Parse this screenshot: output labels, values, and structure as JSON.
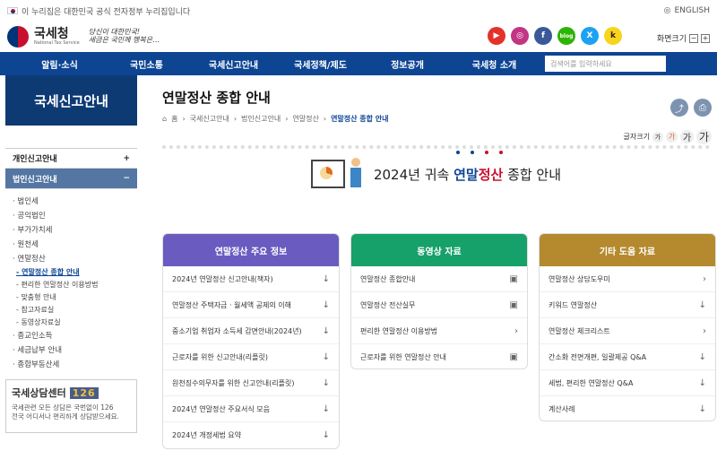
{
  "topbar": {
    "notice": "이 누리집은 대한민국 공식 전자정부 누리집입니다",
    "lang": "ENGLISH"
  },
  "header": {
    "logo": "국세청",
    "logo_sub": "National Tax Service",
    "slogan_line1": "당신이 대한민국!",
    "slogan_line2": "세금은 국민께 행복은…",
    "fontsize_label": "화면크기",
    "fontsize_minus": "−",
    "fontsize_plus": "+",
    "sns": [
      "▶",
      "◎",
      "f",
      "blog",
      "X",
      "k"
    ]
  },
  "gnb": {
    "items": [
      "알림·소식",
      "국민소통",
      "국세신고안내",
      "국세정책/제도",
      "정보공개",
      "국세청 소개"
    ],
    "search_placeholder": "검색어를 입력하세요"
  },
  "lnb": {
    "title": "국세신고안내",
    "sec1": "개인신고안내",
    "sec1_icon": "+",
    "sec2": "법인신고안내",
    "sec2_icon": "−",
    "items": [
      "법인세",
      "공익법인",
      "부가가치세",
      "원천세",
      "연말정산"
    ],
    "subitems": [
      "연말정산 종합 안내",
      "편리한 연말정산 이용방법",
      "맞춤형 안내",
      "참고자료실",
      "동영상자료실"
    ],
    "items2": [
      "종교인소득",
      "세금납부 안내",
      "종합부동산세"
    ],
    "consult_title": "국세상담센터",
    "consult_num": "126",
    "consult_desc1": "국세관련 모든 상담은 국번없이 126",
    "consult_desc2": "전국 어디서나 편리하게 상담받으세요."
  },
  "content": {
    "title": "연말정산 종합 안내",
    "breadcrumb": [
      "홈",
      "국세신고안내",
      "법인신고안내",
      "연말정산",
      "연말정산 종합 안내"
    ],
    "textsize_label": "글자크기",
    "textsize_levels": [
      "가",
      "가",
      "가",
      "가"
    ],
    "banner_prefix": "2024년 귀속 ",
    "banner_hl1": "연말",
    "banner_hl2": "정산",
    "banner_suffix": " 종합 안내"
  },
  "cards": [
    {
      "title": "연말정산 주요 정보",
      "color": "#6a5bc0",
      "rows": [
        {
          "label": "2024년 연말정산 신고안내(책자)",
          "icon": "↓"
        },
        {
          "label": "연말정산 주택자금 · 월세액 공제의 이해",
          "icon": "↓"
        },
        {
          "label": "중소기업 취업자 소득세 감면안내(2024년)",
          "icon": "↓"
        },
        {
          "label": "근로자를 위한 신고안내(리플릿)",
          "icon": "↓"
        },
        {
          "label": "원천징수의무자를 위한 신고안내(리플릿)",
          "icon": "↓"
        },
        {
          "label": "2024년 연말정산 주요서식 모음",
          "icon": "↓"
        },
        {
          "label": "2024년 개정세법 요약",
          "icon": "↓"
        }
      ]
    },
    {
      "title": "동영상 자료",
      "color": "#16a06a",
      "rows": [
        {
          "label": "연말정산 종합안내",
          "icon": "▣"
        },
        {
          "label": "연말정산 전산실무",
          "icon": "▣"
        },
        {
          "label": "편리한 연말정산 이용방법",
          "icon": "›"
        },
        {
          "label": "근로자를 위한 연말정산 안내",
          "icon": "▣"
        }
      ]
    },
    {
      "title": "기타 도움 자료",
      "color": "#b58a2e",
      "rows": [
        {
          "label": "연말정산 상담도우미",
          "icon": "›"
        },
        {
          "label": "키워드 연말정산",
          "icon": "↓"
        },
        {
          "label": "연말정산 체크리스트",
          "icon": "›"
        },
        {
          "label": "간소화 전면개편, 일괄제공 Q&A",
          "icon": "↓"
        },
        {
          "label": "세법, 편리한 연말정산 Q&A",
          "icon": "↓"
        },
        {
          "label": "계산사례",
          "icon": "↓"
        }
      ]
    }
  ],
  "colors": {
    "gnb": "#0d4593",
    "lnb_title": "#0e3a74",
    "lnb_active": "#5476a3"
  }
}
